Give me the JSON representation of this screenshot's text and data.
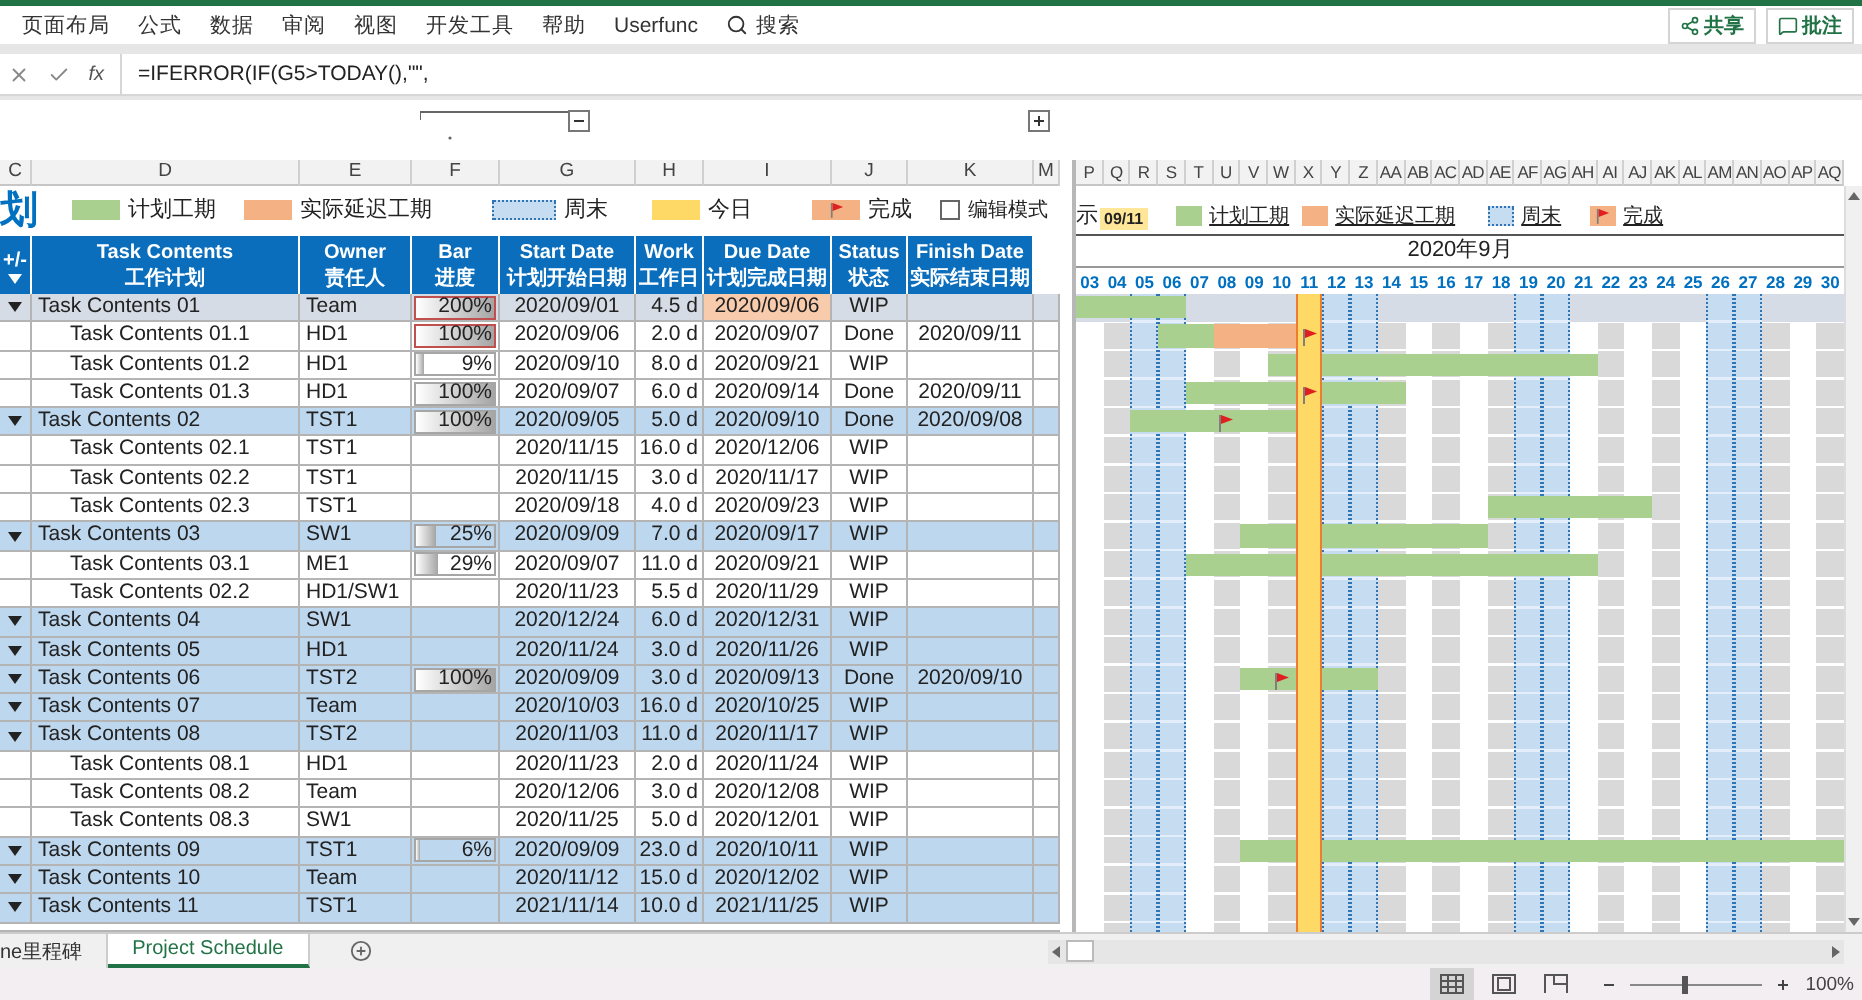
{
  "ribbon": {
    "tabs": [
      "页面布局",
      "公式",
      "数据",
      "审阅",
      "视图",
      "开发工具",
      "帮助",
      "Userfunc"
    ],
    "search": "搜索",
    "buttons": [
      {
        "label": "共享",
        "kind": "share"
      },
      {
        "label": "批注",
        "kind": "comment"
      }
    ]
  },
  "formula_bar": {
    "function_label": "fx",
    "formula": "=IFERROR(IF(G5>TODAY(),\"\","
  },
  "column_letters_left": [
    "C",
    "D",
    "E",
    "F",
    "G",
    "H",
    "I",
    "J",
    "K",
    "M"
  ],
  "column_letters_right": [
    "P",
    "Q",
    "R",
    "S",
    "T",
    "U",
    "V",
    "W",
    "X",
    "Y",
    "Z",
    "AA",
    "AB",
    "AC",
    "AD",
    "AE",
    "AF",
    "AG",
    "AH",
    "AI",
    "AJ",
    "AK",
    "AL",
    "AM",
    "AN",
    "AO",
    "AP",
    "AQ"
  ],
  "legend": {
    "title": "划",
    "items": [
      {
        "label": "计划工期",
        "kind": "plan"
      },
      {
        "label": "实际延迟工期",
        "kind": "delay"
      },
      {
        "label": "周末",
        "kind": "weekend"
      },
      {
        "label": "今日",
        "kind": "today"
      },
      {
        "label": "完成",
        "kind": "done"
      }
    ],
    "edit_mode": {
      "label": "编辑模式",
      "checked": false
    }
  },
  "gantt_legend": {
    "prefix": "示",
    "today_date": "09/11",
    "items": [
      {
        "label": "计划工期",
        "kind": "plan"
      },
      {
        "label": "实际延迟工期",
        "kind": "delay"
      },
      {
        "label": "周末",
        "kind": "weekend"
      },
      {
        "label": "完成",
        "kind": "done"
      }
    ]
  },
  "table": {
    "columns": [
      {
        "title": "+/-"
      },
      {
        "title": "Task Contents",
        "subtitle": "工作计划"
      },
      {
        "title": "Owner",
        "subtitle": "责任人"
      },
      {
        "title": "Bar",
        "subtitle": "进度"
      },
      {
        "title": "Start Date",
        "subtitle": "计划开始日期"
      },
      {
        "title": "Work",
        "subtitle": "工作日"
      },
      {
        "title": "Due Date",
        "subtitle": "计划完成日期"
      },
      {
        "title": "Status",
        "subtitle": "状态"
      },
      {
        "title": "Finish Date",
        "subtitle": "实际结束日期"
      }
    ],
    "rows": [
      {
        "task": "Task Contents 01",
        "owner": "Team",
        "progress": "200%",
        "level": 1,
        "alert": true,
        "start": "2020/09/01",
        "work": "4.5 d",
        "due": "2020/09/06",
        "overdue": true,
        "status": "WIP",
        "selected": true,
        "expanded": true,
        "gantt_cells": [
          {
            "kind": "plan"
          },
          {
            "kind": "plan"
          },
          {
            "kind": "plan"
          },
          {
            "kind": "plan"
          }
        ],
        "children": [
          {
            "task": "Task Contents 01.1",
            "owner": "HD1",
            "progress": "100%",
            "level": 1,
            "alert": true,
            "start": "2020/09/06",
            "work": "2.0 d",
            "due": "2020/09/07",
            "status": "Done",
            "finish": "2020/09/11",
            "selected": false,
            "gantt_cells": [
              {
                "kind": "none"
              },
              {
                "kind": "none"
              },
              {
                "kind": "none"
              },
              {
                "kind": "plan"
              },
              {
                "kind": "plan"
              },
              {
                "kind": "delay"
              },
              {
                "kind": "delay"
              },
              {
                "kind": "delay"
              },
              {
                "kind": "flag"
              }
            ]
          },
          {
            "task": "Task Contents 01.2",
            "owner": "HD1",
            "progress": "9%",
            "level": 0.09,
            "alert": false,
            "start": "2020/09/10",
            "work": "8.0 d",
            "due": "2020/09/21",
            "status": "WIP",
            "selected": false,
            "gantt_cells": [
              {
                "kind": "none"
              },
              {
                "kind": "none"
              },
              {
                "kind": "none"
              },
              {
                "kind": "none"
              },
              {
                "kind": "none"
              },
              {
                "kind": "none"
              },
              {
                "kind": "none"
              },
              {
                "kind": "plan"
              },
              {
                "kind": "plan"
              },
              {
                "kind": "plan"
              },
              {
                "kind": "plan"
              },
              {
                "kind": "plan"
              },
              {
                "kind": "plan"
              },
              {
                "kind": "plan"
              },
              {
                "kind": "plan"
              },
              {
                "kind": "plan"
              },
              {
                "kind": "plan"
              },
              {
                "kind": "plan"
              },
              {
                "kind": "plan"
              }
            ]
          },
          {
            "task": "Task Contents 01.3",
            "owner": "HD1",
            "progress": "100%",
            "level": 1,
            "alert": false,
            "start": "2020/09/07",
            "work": "6.0 d",
            "due": "2020/09/14",
            "status": "Done",
            "finish": "2020/09/11",
            "selected": false,
            "gantt_cells": [
              {
                "kind": "none"
              },
              {
                "kind": "none"
              },
              {
                "kind": "none"
              },
              {
                "kind": "none"
              },
              {
                "kind": "plan"
              },
              {
                "kind": "plan"
              },
              {
                "kind": "plan"
              },
              {
                "kind": "plan"
              },
              {
                "kind": "plan_flag"
              },
              {
                "kind": "plan"
              },
              {
                "kind": "plan"
              },
              {
                "kind": "plan"
              }
            ]
          }
        ]
      },
      {
        "task": "Task Contents 02",
        "owner": "TST1",
        "progress": "100%",
        "level": 1,
        "alert": false,
        "start": "2020/09/05",
        "work": "5.0 d",
        "due": "2020/09/10",
        "status": "Done",
        "finish": "2020/09/08",
        "selected": false,
        "expanded": true,
        "gantt_cells": [
          {
            "kind": "none"
          },
          {
            "kind": "none"
          },
          {
            "kind": "plan"
          },
          {
            "kind": "plan"
          },
          {
            "kind": "plan"
          },
          {
            "kind": "plan_flag"
          },
          {
            "kind": "plan"
          },
          {
            "kind": "plan"
          }
        ],
        "children": [
          {
            "task": "Task Contents 02.1",
            "owner": "TST1",
            "start": "2020/11/15",
            "work": "16.0 d",
            "due": "2020/12/06",
            "status": "WIP",
            "selected": false
          },
          {
            "task": "Task Contents 02.2",
            "owner": "TST1",
            "start": "2020/11/15",
            "work": "3.0 d",
            "due": "2020/11/17",
            "status": "WIP",
            "selected": false
          },
          {
            "task": "Task Contents 02.3",
            "owner": "TST1",
            "start": "2020/09/18",
            "work": "4.0 d",
            "due": "2020/09/23",
            "status": "WIP",
            "selected": false,
            "gantt_cells": [
              {
                "kind": "none"
              },
              {
                "kind": "none"
              },
              {
                "kind": "none"
              },
              {
                "kind": "none"
              },
              {
                "kind": "none"
              },
              {
                "kind": "none"
              },
              {
                "kind": "none"
              },
              {
                "kind": "none"
              },
              {
                "kind": "none"
              },
              {
                "kind": "none"
              },
              {
                "kind": "none"
              },
              {
                "kind": "none"
              },
              {
                "kind": "none"
              },
              {
                "kind": "none"
              },
              {
                "kind": "none"
              },
              {
                "kind": "plan"
              },
              {
                "kind": "plan"
              },
              {
                "kind": "plan"
              },
              {
                "kind": "plan"
              },
              {
                "kind": "plan"
              },
              {
                "kind": "plan"
              }
            ]
          }
        ]
      },
      {
        "task": "Task Contents 03",
        "owner": "SW1",
        "progress": "25%",
        "level": 0.25,
        "alert": false,
        "start": "2020/09/09",
        "work": "7.0 d",
        "due": "2020/09/17",
        "status": "WIP",
        "selected": false,
        "expanded": true,
        "gantt_cells": [
          {
            "kind": "none"
          },
          {
            "kind": "none"
          },
          {
            "kind": "none"
          },
          {
            "kind": "none"
          },
          {
            "kind": "none"
          },
          {
            "kind": "none"
          },
          {
            "kind": "plan"
          },
          {
            "kind": "plan"
          },
          {
            "kind": "plan"
          },
          {
            "kind": "plan"
          },
          {
            "kind": "plan"
          },
          {
            "kind": "plan"
          },
          {
            "kind": "plan"
          },
          {
            "kind": "plan"
          },
          {
            "kind": "plan"
          }
        ],
        "children": [
          {
            "task": "Task Contents 03.1",
            "owner": "ME1",
            "progress": "29%",
            "level": 0.29,
            "alert": false,
            "start": "2020/09/07",
            "work": "11.0 d",
            "due": "2020/09/21",
            "status": "WIP",
            "selected": false,
            "gantt_cells": [
              {
                "kind": "none"
              },
              {
                "kind": "none"
              },
              {
                "kind": "none"
              },
              {
                "kind": "none"
              },
              {
                "kind": "plan"
              },
              {
                "kind": "plan"
              },
              {
                "kind": "plan"
              },
              {
                "kind": "plan"
              },
              {
                "kind": "plan"
              },
              {
                "kind": "plan"
              },
              {
                "kind": "plan"
              },
              {
                "kind": "plan"
              },
              {
                "kind": "plan"
              },
              {
                "kind": "plan"
              },
              {
                "kind": "plan"
              },
              {
                "kind": "plan"
              },
              {
                "kind": "plan"
              },
              {
                "kind": "plan"
              },
              {
                "kind": "plan"
              }
            ]
          },
          {
            "task": "Task Contents 02.2",
            "owner": "HD1/SW1",
            "start": "2020/11/23",
            "work": "5.5 d",
            "due": "2020/11/29",
            "status": "WIP",
            "selected": false
          }
        ]
      },
      {
        "task": "Task Contents 04",
        "owner": "SW1",
        "start": "2020/12/24",
        "work": "6.0 d",
        "due": "2020/12/31",
        "status": "WIP",
        "selected": false,
        "expanded": true
      },
      {
        "task": "Task Contents 05",
        "owner": "HD1",
        "start": "2020/11/24",
        "work": "3.0 d",
        "due": "2020/11/26",
        "status": "WIP",
        "selected": false,
        "expanded": true
      },
      {
        "task": "Task Contents 06",
        "owner": "TST2",
        "progress": "100%",
        "level": 1,
        "alert": false,
        "start": "2020/09/09",
        "work": "3.0 d",
        "due": "2020/09/13",
        "status": "Done",
        "finish": "2020/09/10",
        "selected": false,
        "expanded": true,
        "gantt_cells": [
          {
            "kind": "none"
          },
          {
            "kind": "none"
          },
          {
            "kind": "none"
          },
          {
            "kind": "none"
          },
          {
            "kind": "none"
          },
          {
            "kind": "none"
          },
          {
            "kind": "plan"
          },
          {
            "kind": "plan_flag"
          },
          {
            "kind": "plan"
          },
          {
            "kind": "plan"
          },
          {
            "kind": "plan"
          }
        ]
      },
      {
        "task": "Task Contents 07",
        "owner": "Team",
        "start": "2020/10/03",
        "work": "16.0 d",
        "due": "2020/10/25",
        "status": "WIP",
        "selected": false,
        "expanded": true
      },
      {
        "task": "Task Contents 08",
        "owner": "TST2",
        "start": "2020/11/03",
        "work": "11.0 d",
        "due": "2020/11/17",
        "status": "WIP",
        "selected": false,
        "expanded": true,
        "children": [
          {
            "task": "Task Contents 08.1",
            "owner": "HD1",
            "start": "2020/11/23",
            "work": "2.0 d",
            "due": "2020/11/24",
            "status": "WIP",
            "selected": false
          },
          {
            "task": "Task Contents 08.2",
            "owner": "Team",
            "start": "2020/12/06",
            "work": "3.0 d",
            "due": "2020/12/08",
            "status": "WIP",
            "selected": false
          },
          {
            "task": "Task Contents 08.3",
            "owner": "SW1",
            "start": "2020/11/25",
            "work": "5.0 d",
            "due": "2020/12/01",
            "status": "WIP",
            "selected": false
          }
        ]
      },
      {
        "task": "Task Contents 09",
        "owner": "TST1",
        "progress": "6%",
        "level": 0.06,
        "alert": false,
        "start": "2020/09/09",
        "work": "23.0 d",
        "due": "2020/10/11",
        "status": "WIP",
        "selected": false,
        "expanded": true,
        "gantt_cells": [
          {
            "kind": "none"
          },
          {
            "kind": "none"
          },
          {
            "kind": "none"
          },
          {
            "kind": "none"
          },
          {
            "kind": "none"
          },
          {
            "kind": "none"
          },
          {
            "kind": "plan"
          },
          {
            "kind": "plan"
          },
          {
            "kind": "plan"
          },
          {
            "kind": "plan"
          },
          {
            "kind": "plan"
          },
          {
            "kind": "plan"
          },
          {
            "kind": "plan"
          },
          {
            "kind": "plan"
          },
          {
            "kind": "plan"
          },
          {
            "kind": "plan"
          },
          {
            "kind": "plan"
          },
          {
            "kind": "plan"
          },
          {
            "kind": "plan"
          },
          {
            "kind": "plan"
          },
          {
            "kind": "plan"
          },
          {
            "kind": "plan"
          },
          {
            "kind": "plan"
          },
          {
            "kind": "plan"
          },
          {
            "kind": "plan"
          },
          {
            "kind": "plan"
          },
          {
            "kind": "plan"
          },
          {
            "kind": "plan"
          }
        ]
      },
      {
        "task": "Task Contents 10",
        "owner": "Team",
        "start": "2020/11/12",
        "work": "15.0 d",
        "due": "2020/12/02",
        "status": "WIP",
        "selected": false,
        "expanded": true
      },
      {
        "task": "Task Contents 11",
        "owner": "TST1",
        "start": "2021/11/14",
        "work": "10.0 d",
        "due": "2021/11/25",
        "status": "WIP",
        "selected": false,
        "expanded": true
      }
    ]
  },
  "gantt": {
    "month": "2020年9月",
    "days": [
      {
        "label": "03",
        "kind": "weekday"
      },
      {
        "label": "04",
        "kind": "weekday"
      },
      {
        "label": "05",
        "kind": "weekend"
      },
      {
        "label": "06",
        "kind": "weekend"
      },
      {
        "label": "07",
        "kind": "weekday"
      },
      {
        "label": "08",
        "kind": "weekday"
      },
      {
        "label": "09",
        "kind": "weekday"
      },
      {
        "label": "10",
        "kind": "weekday"
      },
      {
        "label": "11",
        "kind": "today"
      },
      {
        "label": "12",
        "kind": "weekend"
      },
      {
        "label": "13",
        "kind": "weekend"
      },
      {
        "label": "14",
        "kind": "weekday"
      },
      {
        "label": "15",
        "kind": "weekday"
      },
      {
        "label": "16",
        "kind": "weekday"
      },
      {
        "label": "17",
        "kind": "weekday"
      },
      {
        "label": "18",
        "kind": "weekday"
      },
      {
        "label": "19",
        "kind": "weekend"
      },
      {
        "label": "20",
        "kind": "weekend"
      },
      {
        "label": "21",
        "kind": "weekday"
      },
      {
        "label": "22",
        "kind": "weekday"
      },
      {
        "label": "23",
        "kind": "weekday"
      },
      {
        "label": "24",
        "kind": "weekday"
      },
      {
        "label": "25",
        "kind": "weekday"
      },
      {
        "label": "26",
        "kind": "weekend"
      },
      {
        "label": "27",
        "kind": "weekend"
      },
      {
        "label": "28",
        "kind": "weekday"
      },
      {
        "label": "29",
        "kind": "weekday"
      },
      {
        "label": "30",
        "kind": "weekday"
      }
    ]
  },
  "sheet_tabs": [
    {
      "label": "ne里程碑",
      "selected": false
    },
    {
      "label": "Project Schedule",
      "selected": true
    }
  ],
  "status_bar": {
    "views": [
      {
        "kind": "normal",
        "selected": true
      },
      {
        "kind": "page_layout",
        "selected": false
      },
      {
        "kind": "page_break",
        "selected": false
      }
    ],
    "zoom": {
      "level": 0.4,
      "reading": "100%"
    }
  }
}
